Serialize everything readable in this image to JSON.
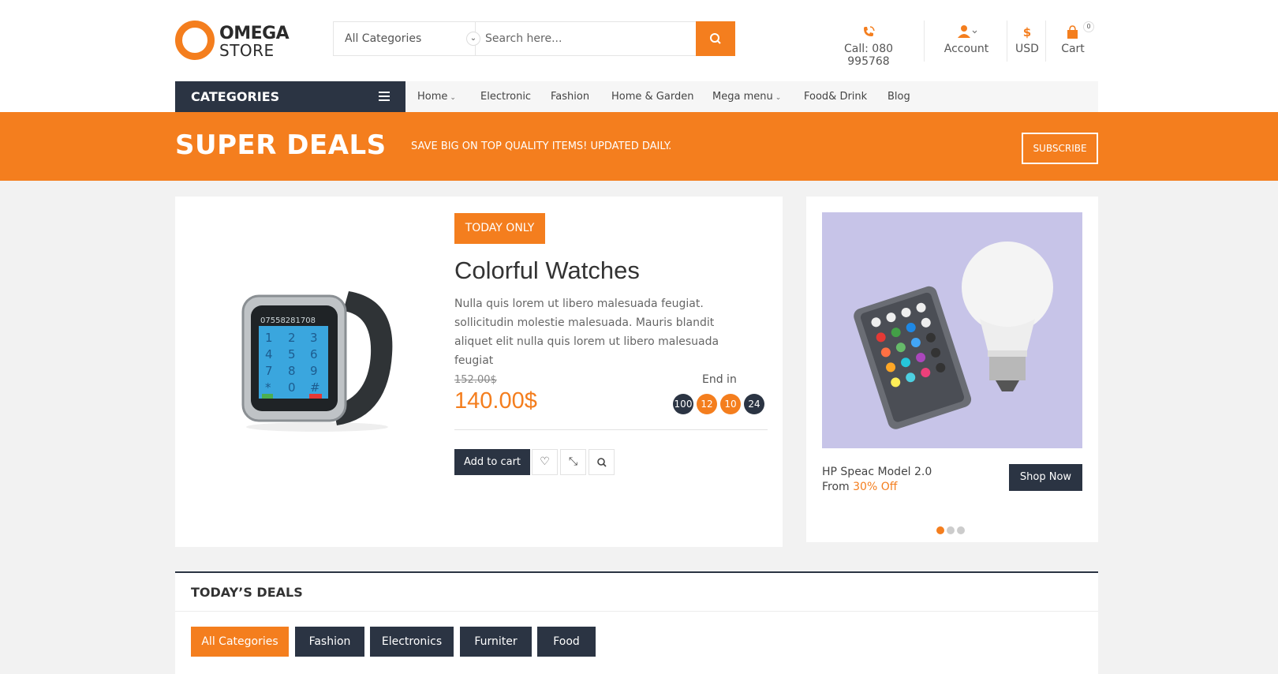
{
  "brand": {
    "line1": "OMEGA",
    "line2": "STORE",
    "accent": "#f47e1e",
    "dark": "#2b3443"
  },
  "search": {
    "category": "All Categories",
    "placeholder": "Search here..."
  },
  "header": {
    "call": "Call: 080 995768",
    "account": "Account",
    "currency_symbol": "$",
    "currency": "USD",
    "cart": "Cart",
    "cart_count": "0"
  },
  "nav": {
    "categories": "CATEGORIES",
    "items": [
      {
        "label": "Home",
        "dropdown": true
      },
      {
        "label": "Electronic",
        "dropdown": false
      },
      {
        "label": "Fashion",
        "dropdown": false
      },
      {
        "label": "Home & Garden",
        "dropdown": false
      },
      {
        "label": "Mega menu",
        "dropdown": true
      },
      {
        "label": "Food& Drink",
        "dropdown": false
      },
      {
        "label": "Blog",
        "dropdown": false
      }
    ]
  },
  "promo": {
    "title": "SUPER DEALS",
    "tagline": "SAVE BIG ON TOP QUALITY ITEMS! UPDATED DAILY.",
    "subscribe": "SUBSCRIBE"
  },
  "deal": {
    "badge": "TODAY ONLY",
    "title": "Colorful Watches",
    "description": "Nulla quis lorem ut libero malesuada feugiat. sollicitudin molestie malesuada. Mauris blandit aliquet elit nulla quis lorem ut libero malesuada feugiat",
    "old_price": "152.00$",
    "price": "140.00$",
    "end_in": "End in",
    "countdown": [
      "100",
      "12",
      "10",
      "24"
    ],
    "add_to_cart": "Add to cart",
    "watch_screen_number": "07558281708"
  },
  "side": {
    "product": "HP Speac Model 2.0",
    "from": "From",
    "discount": "30% Off",
    "shop_now": "Shop Now"
  },
  "todays_deals": {
    "title": "TODAY’S DEALS",
    "tabs": [
      "All Categories",
      "Fashion",
      "Electronics",
      "Furniter",
      "Food"
    ]
  }
}
